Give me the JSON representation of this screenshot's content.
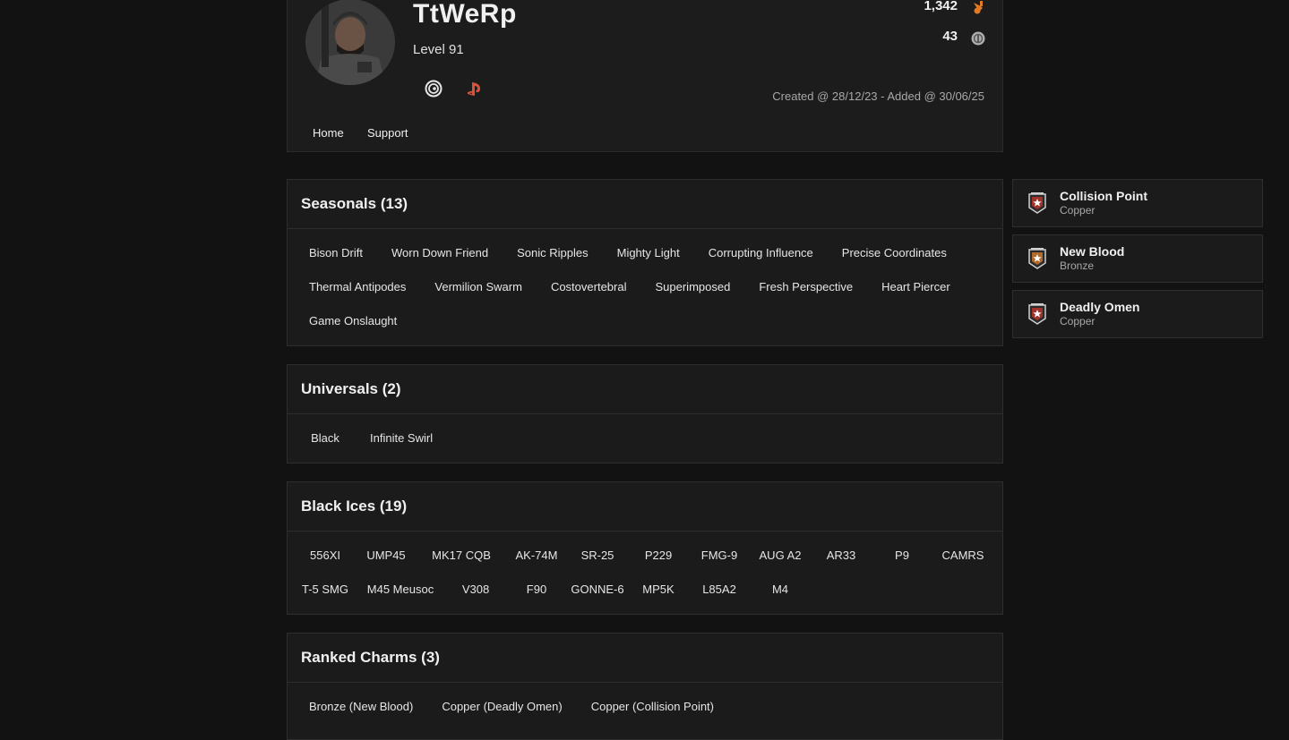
{
  "profile": {
    "username": "TtWeRp",
    "level": "Level 91",
    "stat1": "1,342",
    "stat2": "43",
    "created": "Created @ 28/12/23 - Added @ 30/06/25",
    "nav": [
      "Home",
      "Support"
    ],
    "icons": [
      "ubisoft-icon",
      "playstation-icon",
      "renown-icon",
      "credits-icon"
    ],
    "colors": {
      "accent": "#e07a26",
      "playstation": "#d8533a"
    }
  },
  "seasonals": {
    "title": "Seasonals (13)",
    "items": [
      "Bison Drift",
      "Worn Down Friend",
      "Sonic Ripples",
      "Mighty Light",
      "Corrupting Influence",
      "Precise Coordinates",
      "Thermal Antipodes",
      "Vermilion Swarm",
      "Costovertebral",
      "Superimposed",
      "Fresh Perspective",
      "Heart Piercer",
      "Game Onslaught"
    ]
  },
  "universals": {
    "title": "Universals (2)",
    "items": [
      "Black",
      "Infinite Swirl"
    ]
  },
  "black_ices": {
    "title": "Black Ices (19)",
    "items": [
      "556XI",
      "UMP45",
      "MK17 CQB",
      "AK-74M",
      "SR-25",
      "P229",
      "FMG-9",
      "AUG A2",
      "AR33",
      "P9",
      "CAMRS",
      "T-5 SMG",
      "M45 Meusoc",
      "V308",
      "F90",
      "GONNE-6",
      "MP5K",
      "L85A2",
      "M4"
    ]
  },
  "ranked_charms": {
    "title": "Ranked Charms (3)",
    "items": [
      "Bronze (New Blood)",
      "Copper (Deadly Omen)",
      "Copper (Collision Point)"
    ]
  },
  "badges": [
    {
      "name": "Collision Point",
      "tier": "Copper",
      "icon": "rank-badge-icon"
    },
    {
      "name": "New Blood",
      "tier": "Bronze",
      "icon": "rank-badge-icon"
    },
    {
      "name": "Deadly Omen",
      "tier": "Copper",
      "icon": "rank-badge-icon"
    }
  ]
}
